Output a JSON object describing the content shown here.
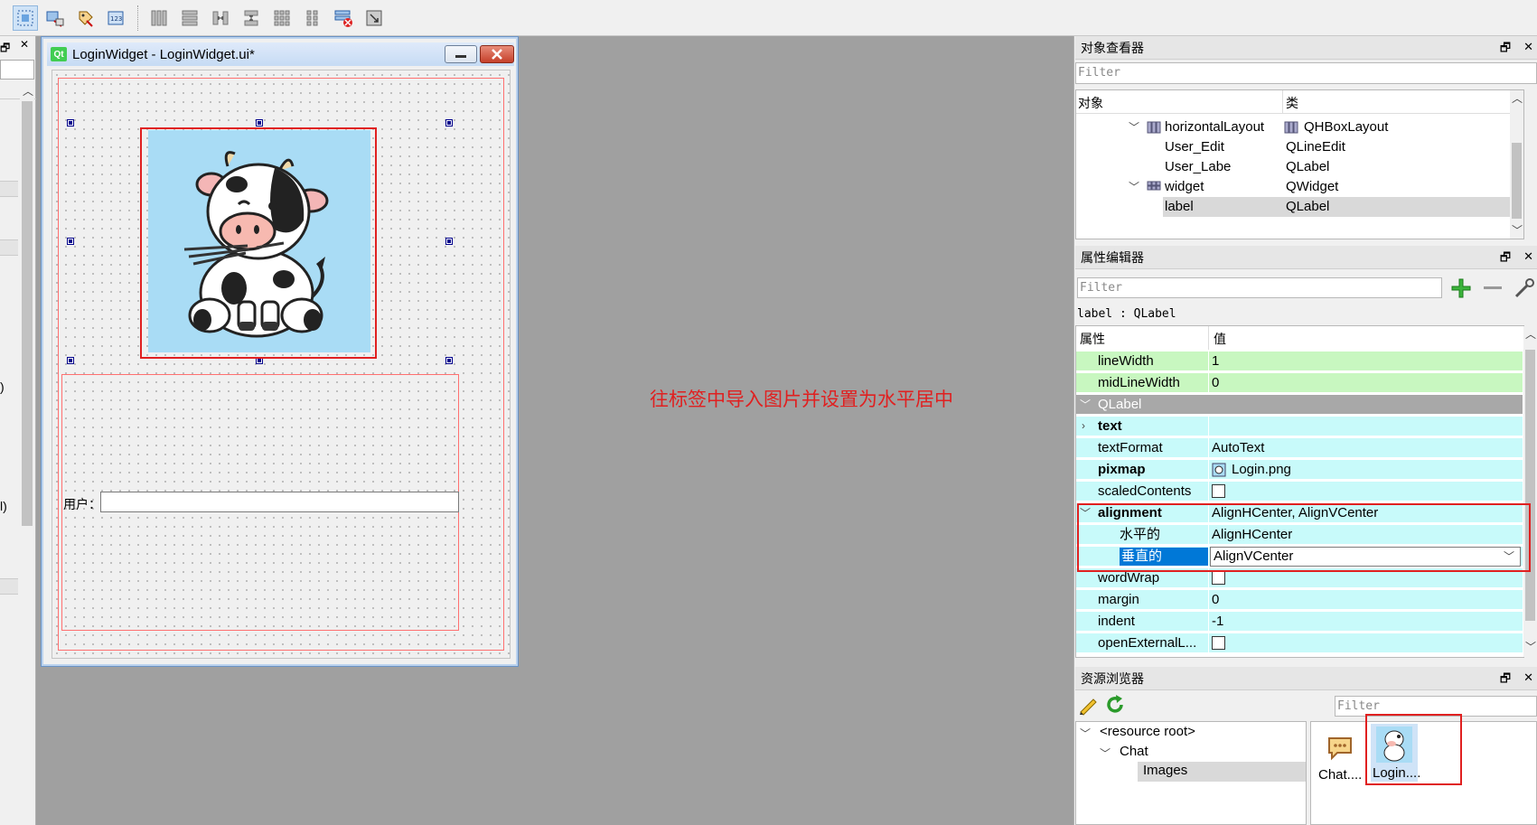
{
  "form_window": {
    "title": "LoginWidget - LoginWidget.ui*",
    "user_label": "用户：",
    "user_input_value": ""
  },
  "annotation": "往标签中导入图片并设置为水平居中",
  "object_inspector": {
    "title": "对象查看器",
    "filter_placeholder": "Filter",
    "columns": {
      "object": "对象",
      "class": "类"
    },
    "rows": [
      {
        "object": "horizontalLayout",
        "class": "QHBoxLayout"
      },
      {
        "object": "User_Edit",
        "class": "QLineEdit"
      },
      {
        "object": "User_Labe",
        "class": "QLabel"
      },
      {
        "object": "widget",
        "class": "QWidget"
      },
      {
        "object": "label",
        "class": "QLabel"
      }
    ]
  },
  "property_editor": {
    "title": "属性编辑器",
    "filter_placeholder": "Filter",
    "object_label": "label : QLabel",
    "columns": {
      "property": "属性",
      "value": "值"
    },
    "rows": [
      {
        "name": "lineWidth",
        "value": "1"
      },
      {
        "name": "midLineWidth",
        "value": "0"
      },
      {
        "name": "QLabel",
        "value": ""
      },
      {
        "name": "text",
        "value": ""
      },
      {
        "name": "textFormat",
        "value": "AutoText"
      },
      {
        "name": "pixmap",
        "value": "Login.png"
      },
      {
        "name": "scaledContents",
        "value": ""
      },
      {
        "name": "alignment",
        "value": "AlignHCenter, AlignVCenter"
      },
      {
        "name": "水平的",
        "value": "AlignHCenter"
      },
      {
        "name": "垂直的",
        "value": "AlignVCenter"
      },
      {
        "name": "wordWrap",
        "value": ""
      },
      {
        "name": "margin",
        "value": "0"
      },
      {
        "name": "indent",
        "value": "-1"
      },
      {
        "name": "openExternalL...",
        "value": ""
      }
    ]
  },
  "resource_browser": {
    "title": "资源浏览器",
    "filter_placeholder": "Filter",
    "tree": [
      "<resource root>",
      "Chat",
      "Images"
    ],
    "files": [
      "Chat....",
      "Login...."
    ]
  },
  "colors": {
    "highlight_red": "#e02020",
    "selection_blue": "#0078d7",
    "prop_green": "#c8f7c0",
    "prop_cyan": "#c8fafa",
    "group_gray": "#a8a8a8"
  }
}
